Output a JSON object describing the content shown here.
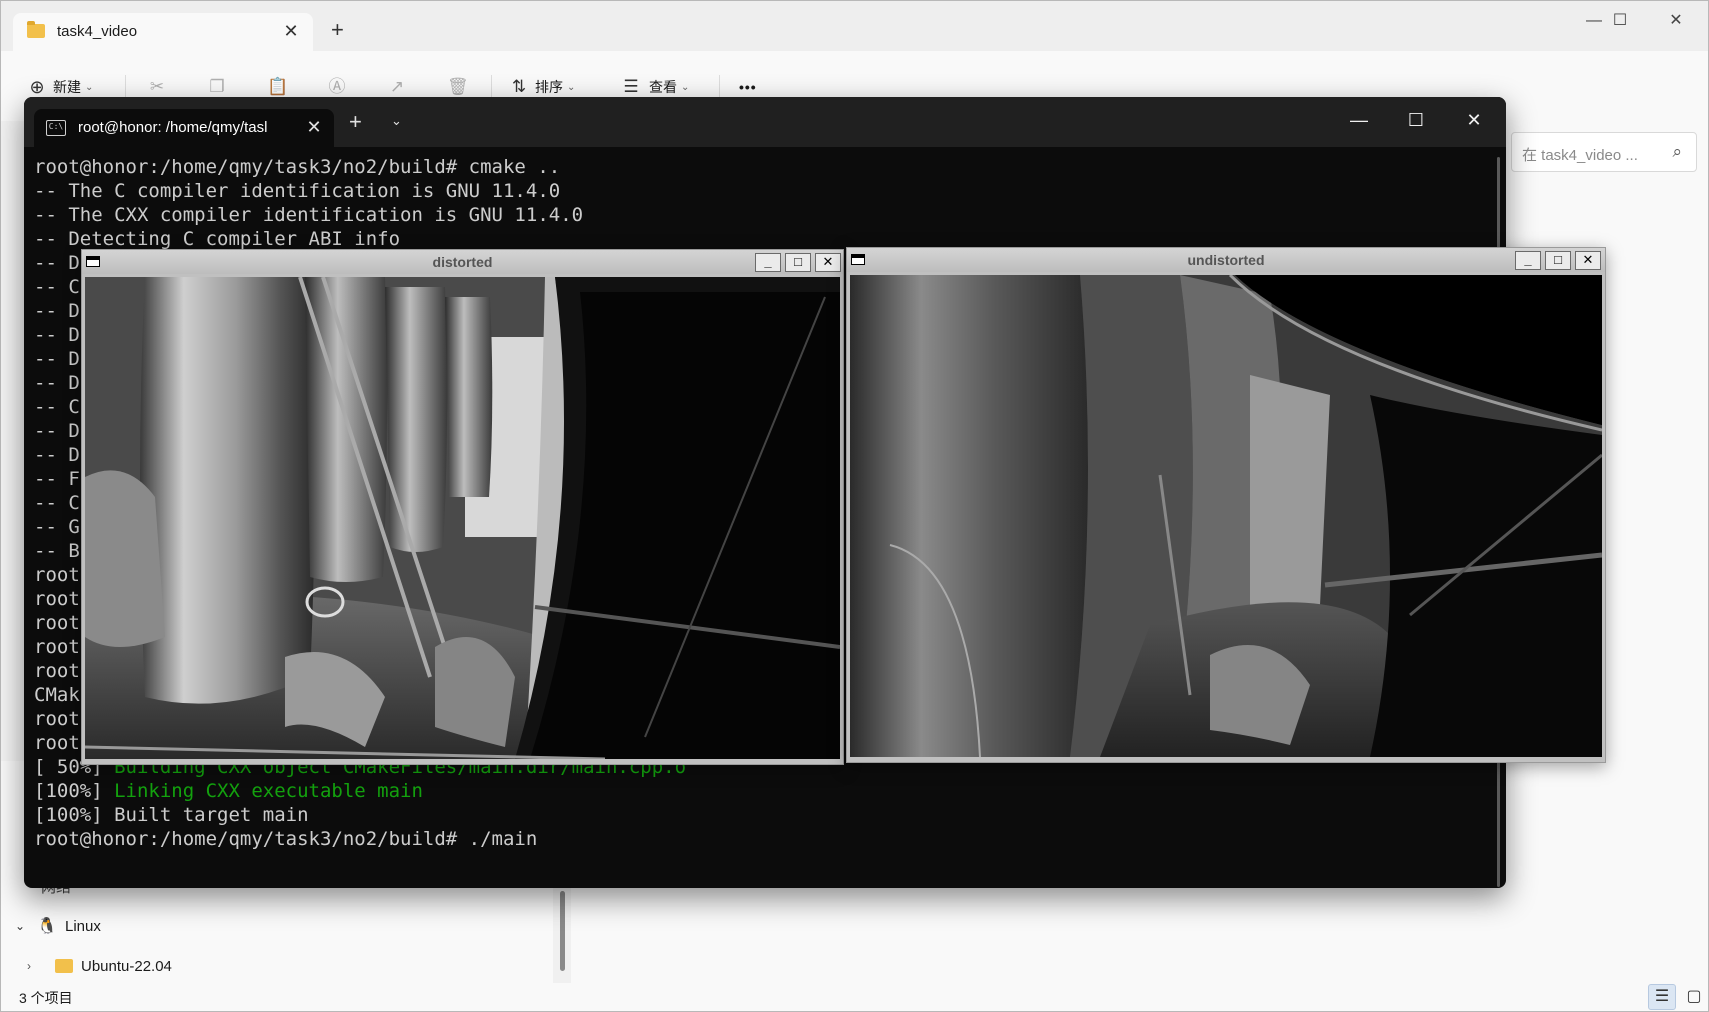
{
  "explorer": {
    "tab_title": "task4_video",
    "tab_close": "✕",
    "new_tab": "+",
    "window_controls": {
      "minimize": "—",
      "maximize": "☐",
      "close": "✕"
    },
    "toolbar": {
      "new_label": "新建",
      "sort_label": "排序",
      "view_label": "查看",
      "more": "•••"
    },
    "search_placeholder": "在 task4_video ...",
    "nav": {
      "network_label": "网络",
      "linux_label": "Linux",
      "ubuntu_label": "Ubuntu-22.04"
    },
    "status_text": "3 个项目"
  },
  "terminal": {
    "tab_title": "root@honor: /home/qmy/tasl",
    "tab_close": "✕",
    "new_tab": "+",
    "dropdown": "⌄",
    "window_controls": {
      "minimize": "—",
      "maximize": "☐",
      "close": "✕"
    },
    "lines": [
      {
        "text": "root@honor:/home/qmy/task3/no2/build# cmake ..",
        "green": ""
      },
      {
        "text": "-- The C compiler identification is GNU 11.4.0",
        "green": ""
      },
      {
        "text": "-- The CXX compiler identification is GNU 11.4.0",
        "green": ""
      },
      {
        "text": "-- Detecting C compiler ABI info",
        "green": ""
      },
      {
        "text": "-- D",
        "green": ""
      },
      {
        "text": "-- C",
        "green": ""
      },
      {
        "text": "-- D",
        "green": ""
      },
      {
        "text": "-- D",
        "green": ""
      },
      {
        "text": "-- D",
        "green": ""
      },
      {
        "text": "-- D",
        "green": ""
      },
      {
        "text": "-- C",
        "green": ""
      },
      {
        "text": "-- D",
        "green": ""
      },
      {
        "text": "-- D",
        "green": ""
      },
      {
        "text": "-- F",
        "green": ""
      },
      {
        "text": "-- C",
        "green": ""
      },
      {
        "text": "-- G",
        "green": ""
      },
      {
        "text": "-- B",
        "green": ""
      },
      {
        "text": "root",
        "green": ""
      },
      {
        "text": "root",
        "green": ""
      },
      {
        "text": "root",
        "green": ""
      },
      {
        "text": "root",
        "green": ""
      },
      {
        "text": "root",
        "green": ""
      },
      {
        "text": "CMak",
        "green": ""
      },
      {
        "text": "root",
        "green": ""
      },
      {
        "text": "root",
        "green": ""
      },
      {
        "text": "[ 50%] ",
        "green": "Building CXX object CMakeFiles/main.dir/main.cpp.o"
      },
      {
        "text": "[100%] ",
        "green": "Linking CXX executable main"
      },
      {
        "text": "[100%] Built target main",
        "green": ""
      },
      {
        "text": "root@honor:/home/qmy/task3/no2/build# ./main",
        "green": ""
      }
    ]
  },
  "windows": {
    "distorted": {
      "title": "distorted",
      "min": "_",
      "max": "□",
      "close": "✕"
    },
    "undistorted": {
      "title": "undistorted",
      "min": "_",
      "max": "□",
      "close": "✕"
    }
  },
  "icons": {
    "explorer": [
      "folder-icon",
      "plus-circle-icon",
      "cut-icon",
      "copy-icon",
      "paste-icon",
      "rename-icon",
      "share-icon",
      "delete-icon",
      "sort-icon",
      "view-icon",
      "more-icon",
      "search-icon",
      "linux-penguin-icon",
      "folder-icon",
      "details-view-icon",
      "tiles-view-icon"
    ],
    "terminal": [
      "terminal-icon"
    ]
  },
  "colors": {
    "terminal_bg": "#0c0c0c",
    "terminal_text": "#cccccc",
    "terminal_green": "#13a10e",
    "explorer_bg": "#f9f9f9",
    "cv_frame": "#c0c0c0"
  }
}
